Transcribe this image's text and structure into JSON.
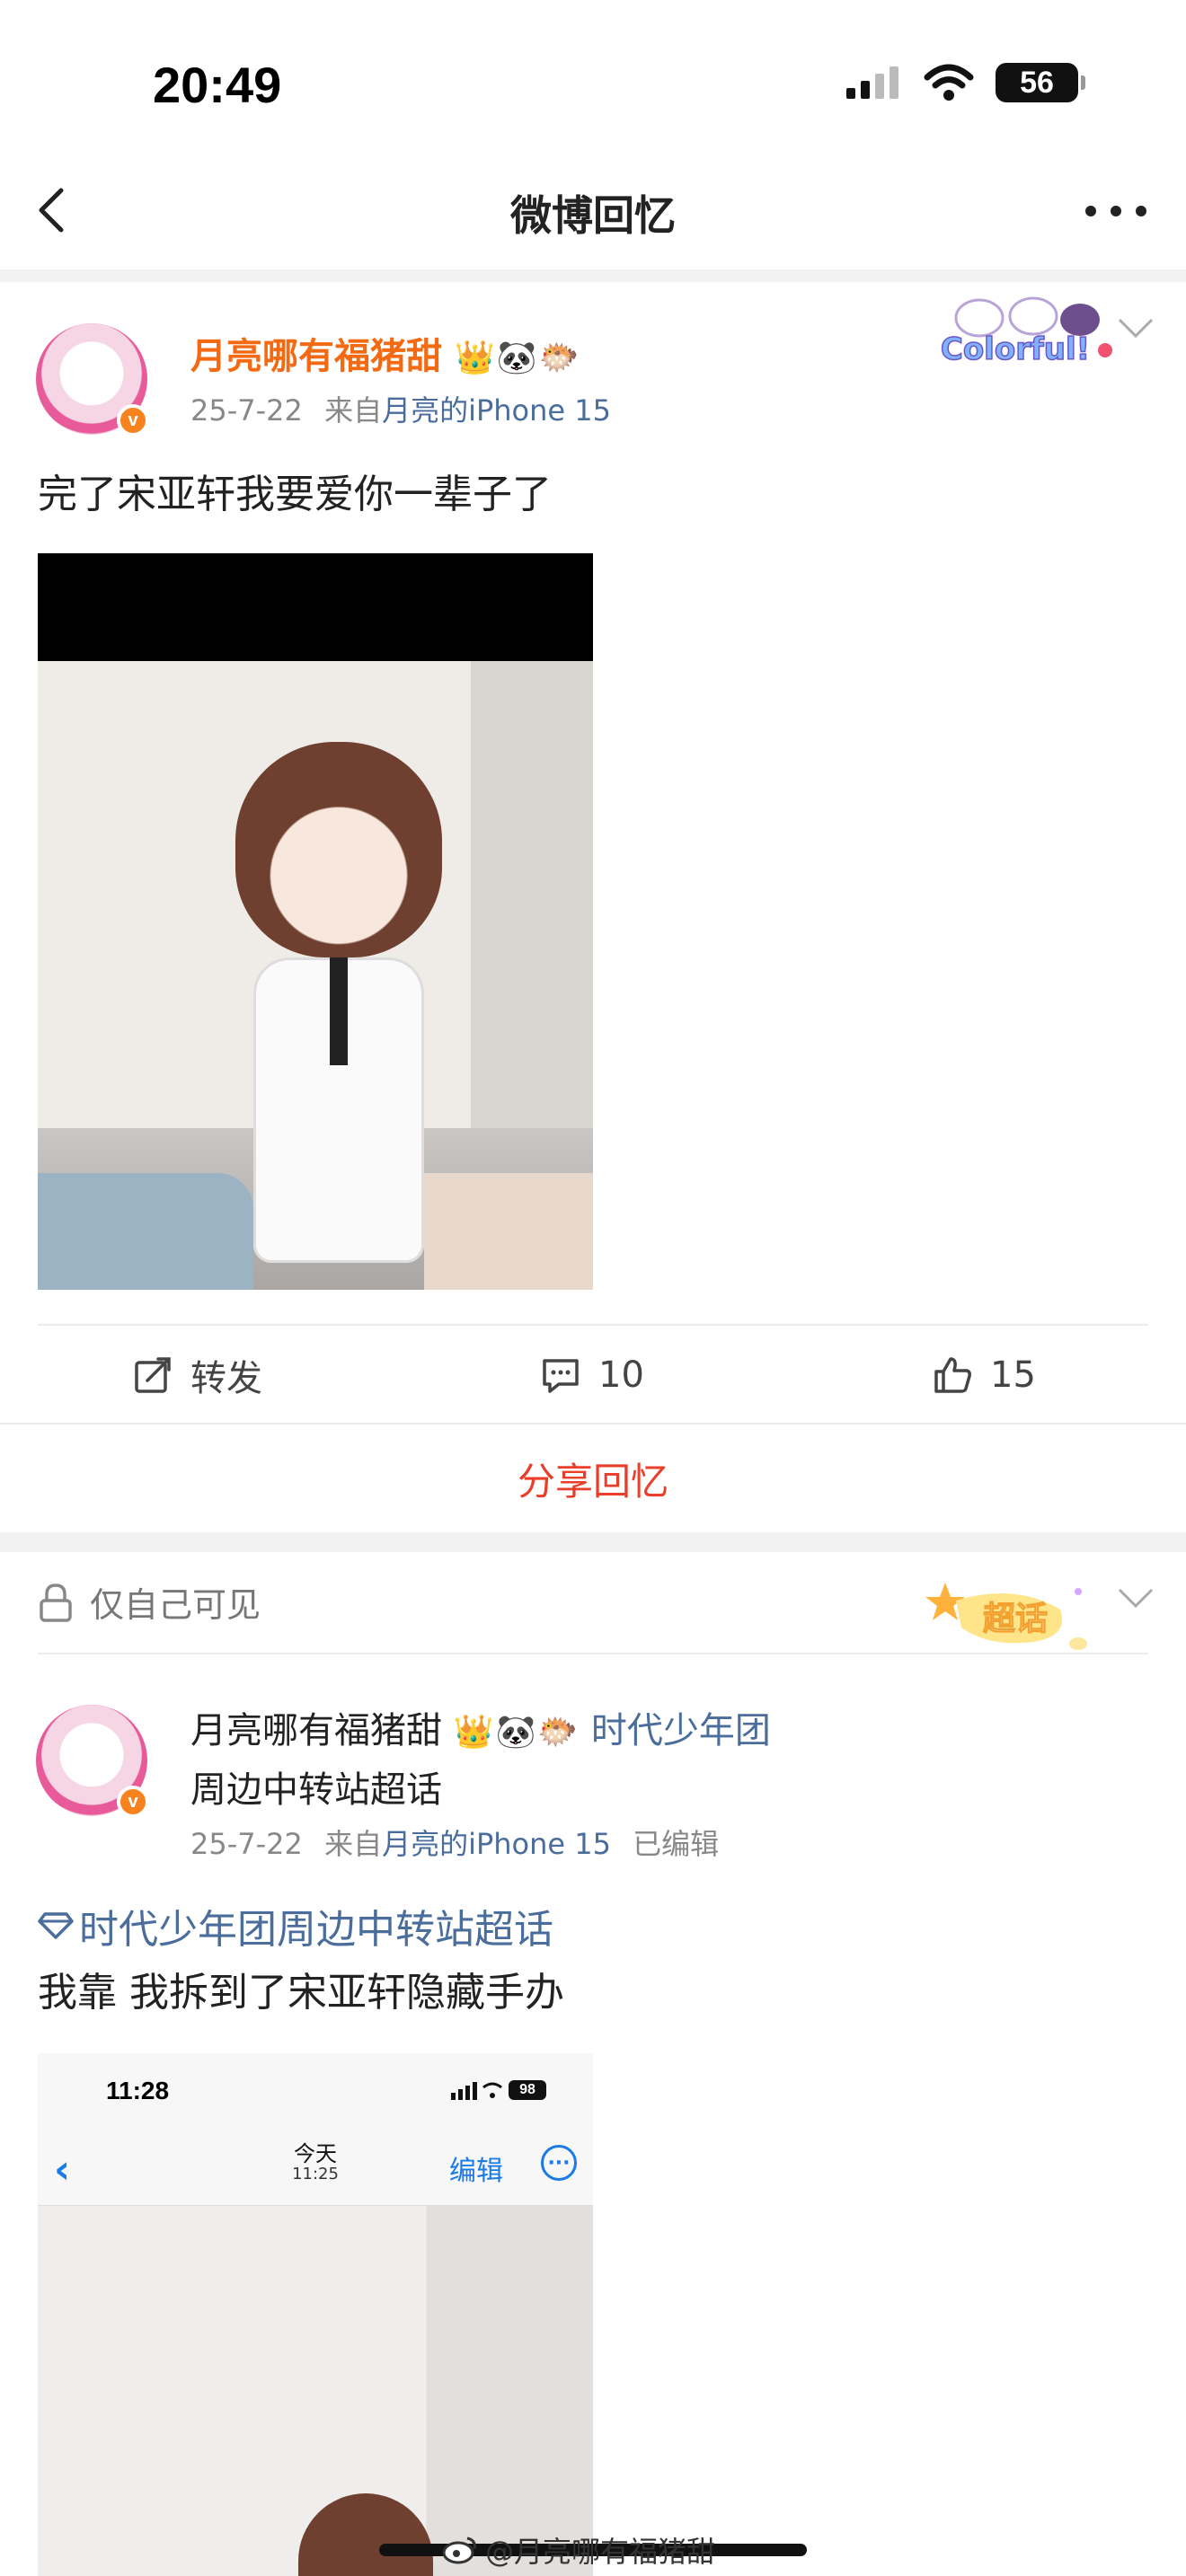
{
  "status_bar": {
    "time": "20:49",
    "battery": "56"
  },
  "nav": {
    "title": "微博回忆"
  },
  "post1": {
    "user_name": "月亮哪有福猪甜",
    "name_emojis": "👑🐼🐡",
    "date": "25-7-22",
    "from_prefix": "来自",
    "device": "月亮的iPhone 15",
    "text": "完了宋亚轩我要爱你一辈子了",
    "badge_text": "Colorful!",
    "actions": {
      "repost_label": "转发",
      "comment_count": "10",
      "like_count": "15"
    },
    "share_label": "分享回忆"
  },
  "post2": {
    "visibility": "仅自己可见",
    "badge_text": "超话",
    "user_name": "月亮哪有福猪甜",
    "name_emojis": "👑🐼🐡",
    "topic_tail_line1": "时代少年团",
    "topic_tail_line2": "周边中转站超话",
    "date": "25-7-22",
    "from_prefix": "来自",
    "device": "月亮的iPhone 15",
    "edited": "已编辑",
    "topic_link": "时代少年团周边中转站超话",
    "text": "我靠 我拆到了宋亚轩隐藏手办",
    "screenshot": {
      "time": "11:28",
      "battery": "98",
      "title": "今天",
      "subtitle": "11:25",
      "edit_label": "编辑",
      "more_label": "···"
    }
  },
  "watermark": "@月亮哪有福猪甜"
}
